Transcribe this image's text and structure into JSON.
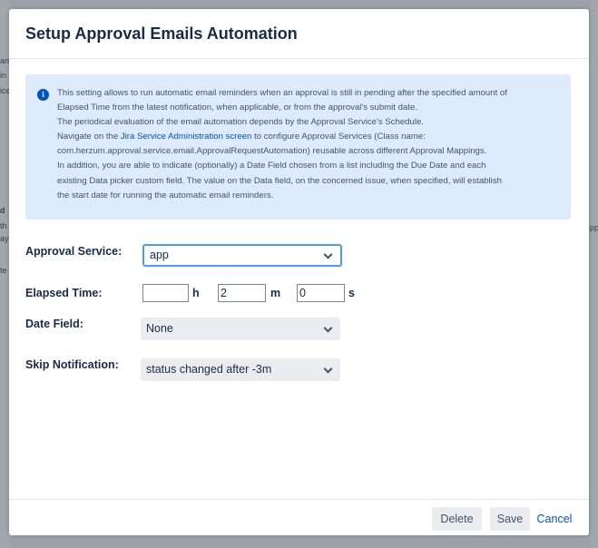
{
  "background": {
    "left_fragments": [
      "arr",
      "in",
      "ice",
      "d",
      "th",
      "ay",
      "te"
    ],
    "right_fragments": [
      "pp"
    ]
  },
  "dialog": {
    "title": "Setup Approval Emails Automation",
    "info": {
      "icon": "info-icon",
      "line1": "This setting allows to run automatic email reminders when an approval is still in pending after the specified amount of",
      "line2": "Elapsed Time from the latest notification, when applicable, or from the approval's submit date.",
      "line3": "The periodical evaluation of the email automation depends by the Approval Service's Schedule.",
      "line4_prefix": "Navigate on the ",
      "line4_link": "Jira Service Administration screen",
      "line4_suffix": " to configure Approval Services (Class name:",
      "line5": "com.herzum.approval.service.email.ApprovalRequestAutomation) reusable across different Approval Mappings.",
      "line6": "In addition, you are able to indicate (optionally) a Date Field chosen from a list including the Due Date and each",
      "line7": "existing Data picker custom field. The value on the Data field, on the concerned issue, when specified, will establish",
      "line8": "the start date for running the automatic email reminders."
    },
    "form": {
      "approval_service": {
        "label": "Approval Service:",
        "value": "app"
      },
      "elapsed_time": {
        "label": "Elapsed Time:",
        "hours": "",
        "hours_unit": "h",
        "minutes": "2",
        "minutes_unit": "m",
        "seconds": "0",
        "seconds_unit": "s"
      },
      "date_field": {
        "label": "Date Field:",
        "value": "None"
      },
      "skip_notification": {
        "label": "Skip Notification:",
        "value": "status changed after -3m"
      }
    },
    "footer": {
      "delete_label": "Delete",
      "save_label": "Save",
      "cancel_label": "Cancel"
    }
  },
  "colors": {
    "accent": "#0052cc",
    "info_bg": "#deebff",
    "focus_border": "#4c9aff",
    "button_grey": "#ebecf0"
  }
}
